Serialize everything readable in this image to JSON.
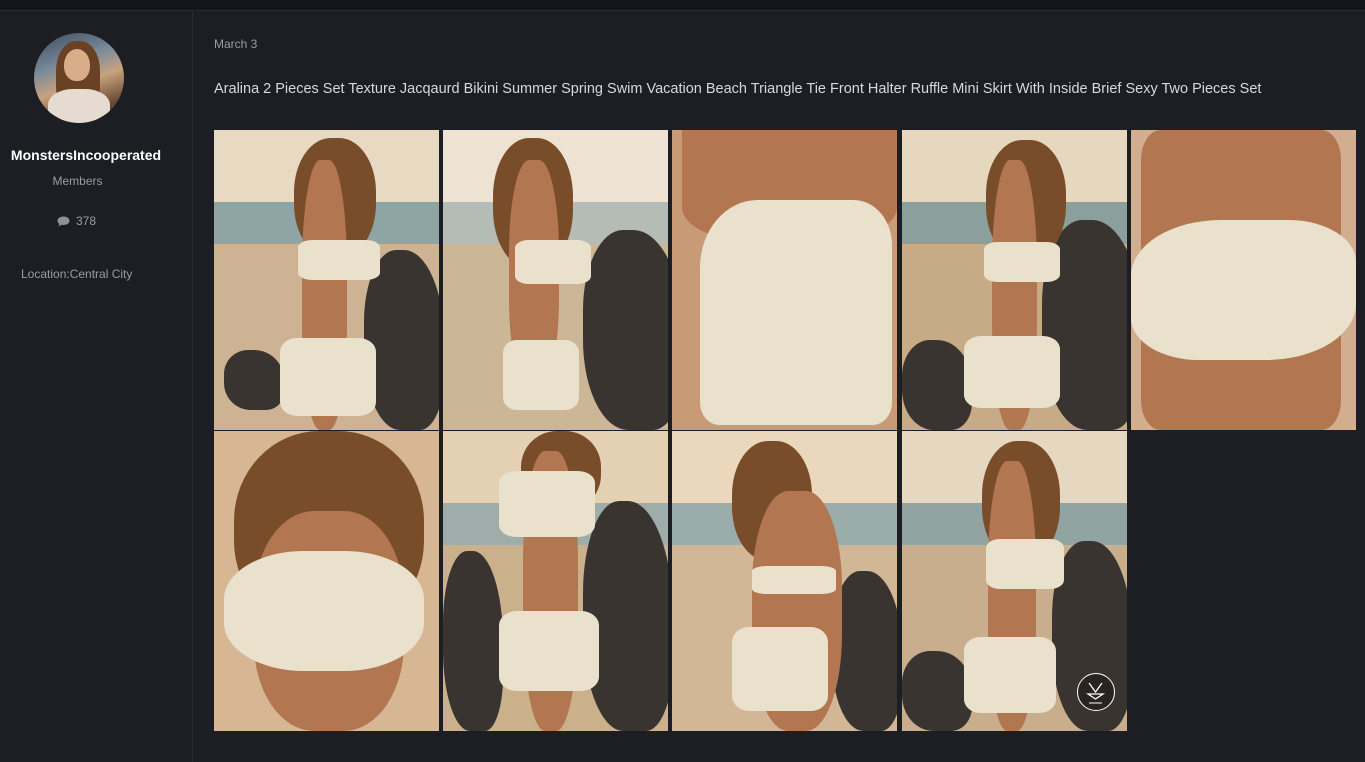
{
  "profile": {
    "username": "MonstersIncooperated",
    "role": "Members",
    "post_count": "378",
    "location": "Location:Central City",
    "icons": {
      "avatar": "user-avatar",
      "posts": "comment-bubble-icon"
    }
  },
  "post": {
    "date": "March 3",
    "title": "Aralina 2 Pieces Set Texture Jacqaurd Bikini Summer Spring Swim Vacation Beach Triangle Tie Front Halter Ruffle Mini Skirt With Inside Brief Sexy Two Pieces Set",
    "image_count_rows": 2,
    "images": [
      "bikini-photo-1",
      "bikini-photo-2",
      "bikini-photo-3",
      "bikini-photo-4",
      "bikini-photo-5",
      "bikini-photo-6",
      "bikini-photo-7",
      "bikini-photo-8",
      "bikini-photo-9"
    ]
  },
  "colors": {
    "background": "#1c1e24",
    "sidebar_border": "#2a2c33",
    "username": "#ffffff",
    "muted_text": "#9a9ca3",
    "title_text": "#d6d8dc"
  }
}
